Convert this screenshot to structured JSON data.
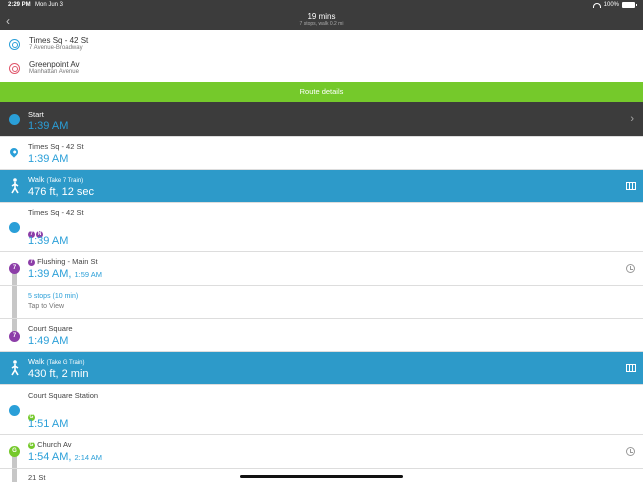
{
  "status": {
    "time": "2:29 PM",
    "date": "Mon Jun 3",
    "battery": "100%"
  },
  "nav": {
    "title": "19 mins",
    "subtitle": "7 stops, walk 0.2 mi",
    "back_icon": "chevron-left-icon"
  },
  "origin": {
    "name": "Times Sq - 42 St",
    "sub": "7 Avenue-Broadway"
  },
  "destination": {
    "name": "Greenpoint Av",
    "sub": "Manhattan Avenue"
  },
  "route_details_label": "Route details",
  "steps": {
    "start": {
      "label": "Start",
      "time": "1:39 AM"
    },
    "times_sq": {
      "label": "Times Sq - 42 St",
      "time": "1:39 AM"
    },
    "walk1": {
      "label": "Walk",
      "note": "(Take 7 Train)",
      "value": "476 ft, 12 sec"
    },
    "board1": {
      "label": "Times Sq - 42 St",
      "time": "1:39 AM",
      "lines": [
        "7",
        "N"
      ]
    },
    "train1": {
      "line": "7",
      "dest": "Flushing - Main St",
      "time": "1:39 AM,",
      "time2": "1:59 AM",
      "stops": "5 stops (10 min)",
      "tap": "Tap to View"
    },
    "court_sq": {
      "label": "Court Square",
      "time": "1:49 AM",
      "line": "7"
    },
    "walk2": {
      "label": "Walk",
      "note": "(Take G Train)",
      "value": "430 ft, 2 min"
    },
    "board2": {
      "label": "Court Square Station",
      "time": "1:51 AM",
      "line": "G"
    },
    "train2": {
      "line": "G",
      "dest": "Church Av",
      "time": "1:54 AM,",
      "time2": "2:14 AM"
    },
    "next": {
      "label": "21 St"
    }
  },
  "colors": {
    "green": "#75c92b",
    "blue": "#2d9ac9",
    "purple": "#8c3ea8",
    "dark": "#3c3c3c"
  }
}
